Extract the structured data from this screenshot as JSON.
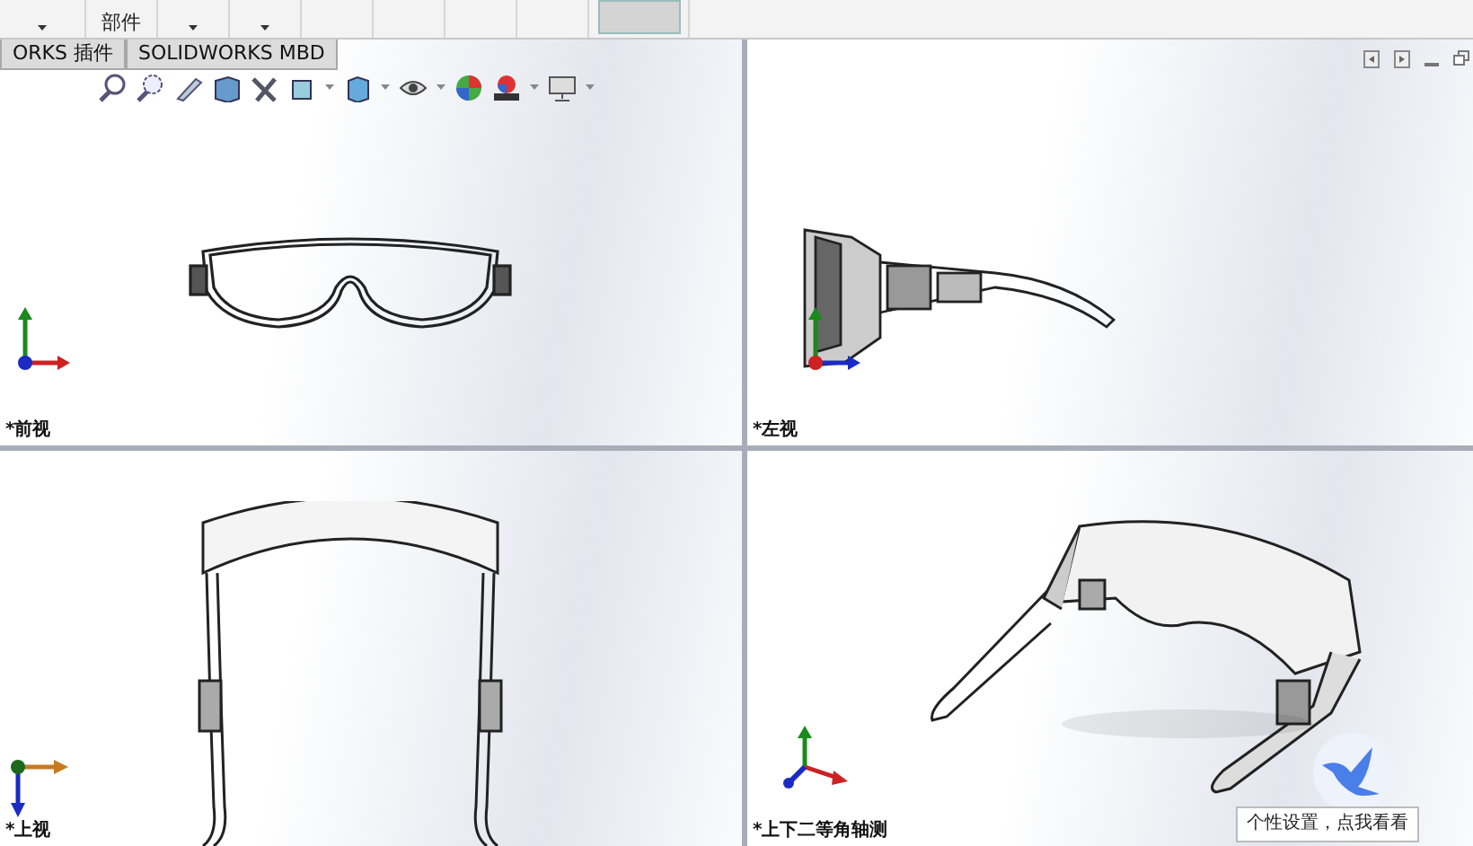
{
  "toolbar": {
    "items": [
      {
        "kind": "dropdown"
      },
      {
        "kind": "text",
        "label": "部件"
      },
      {
        "kind": "dropdown"
      },
      {
        "kind": "dropdown"
      },
      {
        "kind": "blank"
      },
      {
        "kind": "blank"
      },
      {
        "kind": "blank"
      },
      {
        "kind": "blank"
      },
      {
        "kind": "block"
      }
    ]
  },
  "tabs": [
    {
      "label": "ORKS 插件",
      "selected": false
    },
    {
      "label": "SOLIDWORKS MBD",
      "selected": false
    }
  ],
  "viewports": [
    {
      "kind": "front",
      "label": "*前视"
    },
    {
      "kind": "side",
      "label": "*左视"
    },
    {
      "kind": "top",
      "label": "*上视"
    },
    {
      "kind": "iso",
      "label": "*上下二等角轴测"
    }
  ],
  "tooltip": {
    "text": "个性设置，点我看看"
  }
}
